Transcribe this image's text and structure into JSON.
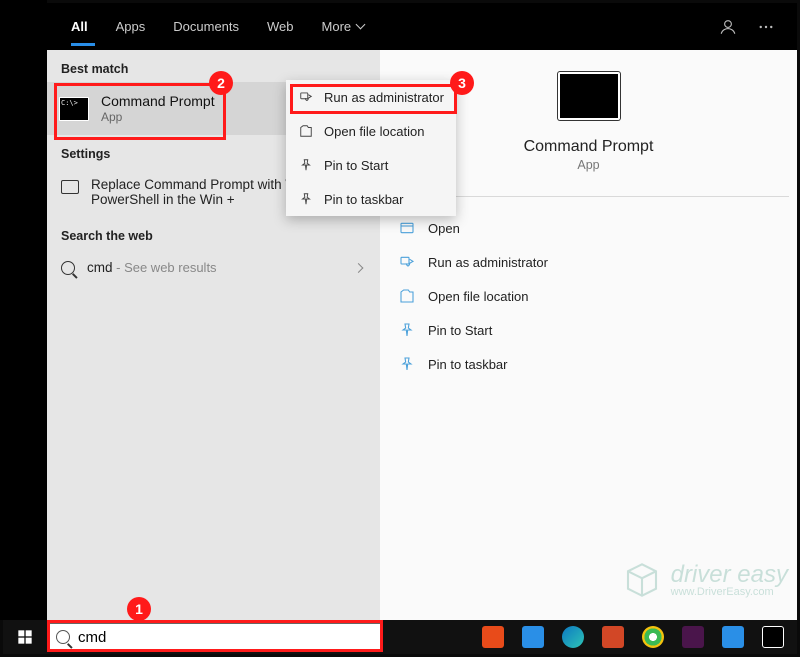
{
  "tabs": {
    "all": "All",
    "apps": "Apps",
    "documents": "Documents",
    "web": "Web",
    "more": "More"
  },
  "sections": {
    "best": "Best match",
    "settings": "Settings",
    "web": "Search the web"
  },
  "best_match": {
    "title": "Command Prompt",
    "sub": "App"
  },
  "setting_item": "Replace Command Prompt with Windows PowerShell in the Win + ",
  "web_item": {
    "term": "cmd",
    "hint": " - See web results"
  },
  "ctx": {
    "run_admin": "Run as administrator",
    "open_loc": "Open file location",
    "pin_start": "Pin to Start",
    "pin_taskbar": "Pin to taskbar"
  },
  "preview": {
    "title": "Command Prompt",
    "sub": "App"
  },
  "actions": {
    "open": "Open",
    "run_admin": "Run as administrator",
    "open_loc": "Open file location",
    "pin_start": "Pin to Start",
    "pin_taskbar": "Pin to taskbar"
  },
  "search": {
    "value": "cmd"
  },
  "callouts": {
    "c1": "1",
    "c2": "2",
    "c3": "3"
  },
  "watermark": {
    "brand": "driver easy",
    "url": "www.DriverEasy.com"
  }
}
